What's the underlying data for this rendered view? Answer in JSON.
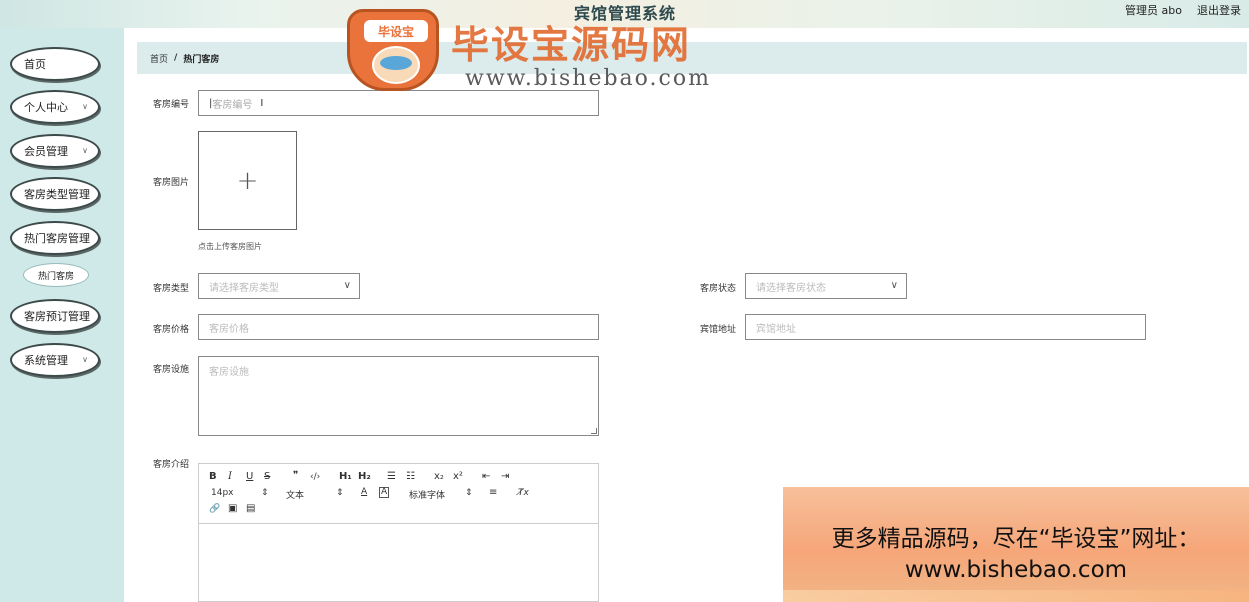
{
  "header": {
    "title": "宾馆管理系统",
    "user": "管理员 abo",
    "logout": "退出登录"
  },
  "sidebar": {
    "items": [
      {
        "label": "首页"
      },
      {
        "label": "个人中心"
      },
      {
        "label": "会员管理"
      },
      {
        "label": "客房类型管理"
      },
      {
        "label": "热门客房管理"
      },
      {
        "label": "客房预订管理"
      },
      {
        "label": "系统管理"
      }
    ],
    "submenu": {
      "label": "热门客房"
    }
  },
  "breadcrumb": {
    "home": "首页",
    "separator": "/",
    "current": "热门客房"
  },
  "form": {
    "room_no": {
      "label": "客房编号",
      "placeholder": "客房编号"
    },
    "room_image": {
      "label": "客房图片",
      "hint": "点击上传客房图片",
      "plus": "+"
    },
    "room_type": {
      "label": "客房类型",
      "placeholder": "请选择客房类型"
    },
    "room_status": {
      "label": "客房状态",
      "placeholder": "请选择客房状态"
    },
    "room_price": {
      "label": "客房价格",
      "placeholder": "客房价格"
    },
    "hotel_address": {
      "label": "宾馆地址",
      "placeholder": "宾馆地址"
    },
    "room_facilities": {
      "label": "客房设施",
      "placeholder": "客房设施"
    },
    "room_intro": {
      "label": "客房介绍"
    }
  },
  "editor_toolbar": {
    "bold": "B",
    "italic": "I",
    "underline": "U",
    "strike": "S",
    "quote": "❞",
    "code": "‹/›",
    "h1": "H₁",
    "h2": "H₂",
    "ordered_list": "☰",
    "bullet_list": "☷",
    "subscript": "x₂",
    "superscript": "x²",
    "outdent": "⇤",
    "indent": "⇥",
    "font_size": "14px",
    "text_style": "文本",
    "font_color": "A",
    "bg_color": "A",
    "font_family": "标准字体",
    "align": "≡",
    "clear_format": "T̸x",
    "link": "🔗",
    "image": "▣",
    "video": "▤"
  },
  "watermark": {
    "badge": "毕设宝",
    "title": "毕设宝源码网",
    "url": "www.bishebao.com"
  },
  "promo": {
    "line1": "更多精品源码，尽在“毕设宝”网址：",
    "line2": "www.bishebao.com"
  },
  "colors": {
    "accent": "#dcebeb",
    "sidebar": "#cfe8e8",
    "brand": "#e9733a"
  }
}
